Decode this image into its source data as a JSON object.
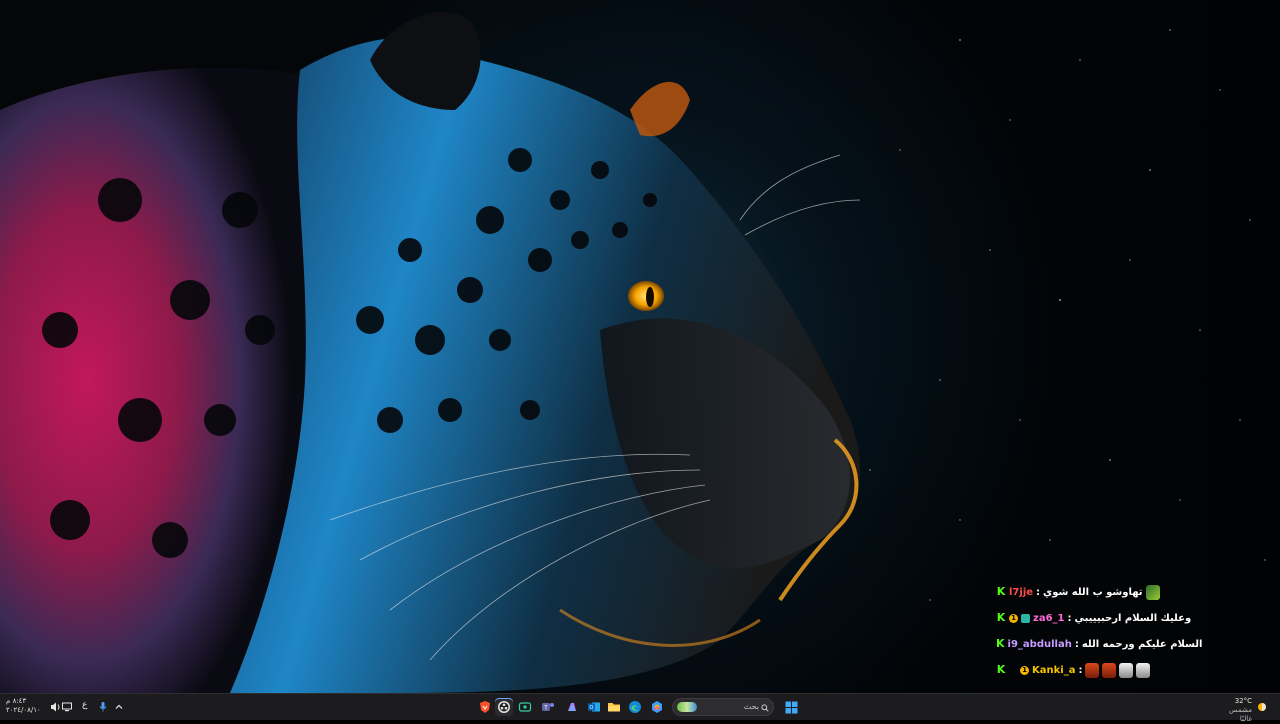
{
  "chat": {
    "messages": [
      {
        "user": "l7jje",
        "separator": " : ",
        "message": "تهاوشو ب الله شوي",
        "user_color": "#ff4b4b"
      },
      {
        "user": "za6_1",
        "separator": " : ",
        "message": "وعليك السلام ارحبيييبي",
        "user_color": "#ff6ad5"
      },
      {
        "user": "i9_abdullah",
        "separator": " : ",
        "message": "السلام عليكم ورحمه الله",
        "user_color": "#c79bff"
      },
      {
        "user": "Kanki_a",
        "separator": " : ",
        "message": "",
        "user_color": "#f6c300"
      }
    ]
  },
  "taskbar": {
    "search_placeholder": "بحث",
    "clock_time": "٨:٤٣ م",
    "clock_date": "٢٠٢٤/٠٨/١٠",
    "weather_temp": "32°C",
    "weather_desc": "مشمس غالبًا",
    "language": "ع"
  },
  "colors": {
    "kick_green": "#53fc18",
    "taskbar_bg": "#1c1c1e"
  },
  "icons": {
    "pinned_apps": [
      "brave-browser-icon",
      "obs-icon",
      "copilot-icon",
      "teams-icon",
      "whatsapp-icon",
      "outlook-icon",
      "file-explorer-icon",
      "edge-icon",
      "photos-icon"
    ],
    "start": "windows-start-icon"
  }
}
